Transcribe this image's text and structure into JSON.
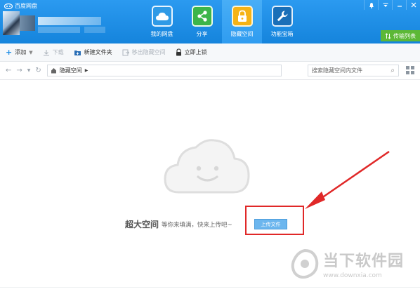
{
  "app": {
    "title": "百度网盘"
  },
  "nav": {
    "items": [
      {
        "label": "我的网盘",
        "icon": "cloud-icon"
      },
      {
        "label": "分享",
        "icon": "share-icon"
      },
      {
        "label": "隐藏空间",
        "icon": "lock-icon",
        "active": true
      },
      {
        "label": "功能宝箱",
        "icon": "wrench-icon"
      }
    ]
  },
  "window": {
    "transfer_label": "传输列表"
  },
  "toolbar": {
    "add_label": "添加",
    "download_label": "下载",
    "new_folder_label": "新建文件夹",
    "move_out_label": "移出隐藏空间",
    "lock_label": "立即上锁"
  },
  "address": {
    "current_path": "隐藏空间",
    "search_placeholder": "搜索隐藏空间内文件"
  },
  "main": {
    "promo_title": "超大空间",
    "promo_sub": "等你来填满，快来上传吧~",
    "upload_label": "上传文件"
  },
  "watermark": {
    "text": "当下软件园",
    "url": "www.downxia.com"
  },
  "colors": {
    "header": "#1f8fe6",
    "highlight": "#e02828",
    "transfer": "#5cb836"
  }
}
